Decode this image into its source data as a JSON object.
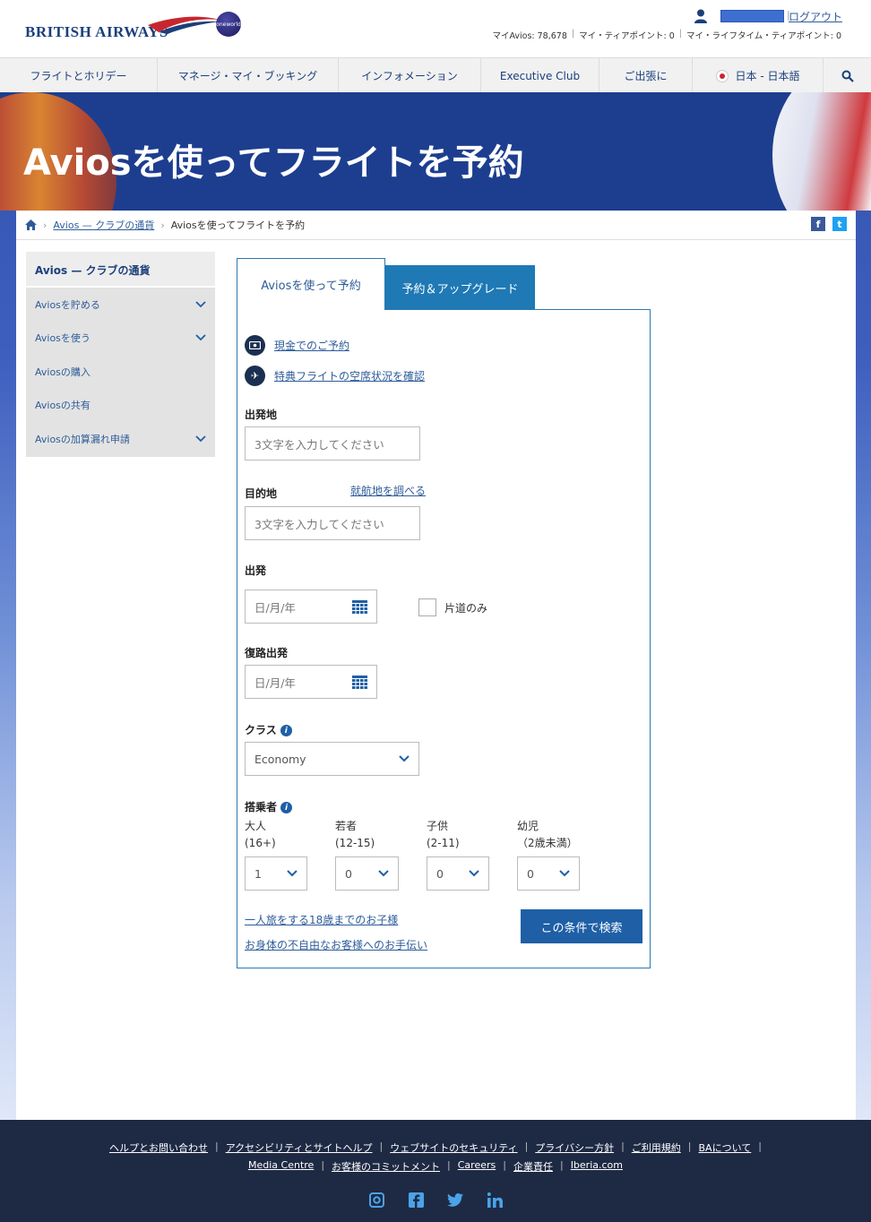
{
  "brand": {
    "logo_text": "BRITISH AIRWAYS",
    "alliance": "oneworld"
  },
  "account": {
    "logout_label": "ログアウト",
    "avios_label": "マイAvios: 78,678",
    "tier_points_label": "マイ・ティアポイント: 0",
    "lifetime_tier_points_label": "マイ・ライフタイム・ティアポイント: 0"
  },
  "nav": {
    "items": [
      {
        "label": "フライトとホリデー"
      },
      {
        "label": "マネージ・マイ・ブッキング"
      },
      {
        "label": "インフォメーション"
      },
      {
        "label": "Executive Club"
      },
      {
        "label": "ご出張に"
      },
      {
        "label": "日本 - 日本語"
      }
    ]
  },
  "hero": {
    "title": "Aviosを使ってフライトを予約"
  },
  "breadcrumb": {
    "link1": "Avios — クラブの通貨",
    "current": "Aviosを使ってフライトを予約"
  },
  "sidebar": {
    "title": "Avios — クラブの通貨",
    "items": [
      {
        "label": "Aviosを貯める"
      },
      {
        "label": "Aviosを使う"
      },
      {
        "label": "Aviosの購入"
      },
      {
        "label": "Aviosの共有"
      },
      {
        "label": "Aviosの加算漏れ申請"
      }
    ]
  },
  "tabs": {
    "active": "Aviosを使って予約",
    "inactive": "予約＆アップグレード"
  },
  "form": {
    "cash_link": "現金でのご予約",
    "availability_link": "特典フライトの空席状況を確認",
    "from_label": "出発地",
    "from_placeholder": "3文字を入力してください",
    "to_label": "目的地",
    "routes_link": "就航地を調べる",
    "to_placeholder": "3文字を入力してください",
    "depart_label": "出発",
    "date_placeholder": "日/月/年",
    "oneway_label": "片道のみ",
    "return_label": "復路出発",
    "class_label": "クラス",
    "class_value": "Economy",
    "passengers_label": "搭乗者",
    "adults_label": "大人",
    "adults_sub": "(16+)",
    "adults_value": "1",
    "youth_label": "若者",
    "youth_sub": "(12-15)",
    "youth_value": "0",
    "children_label": "子供",
    "children_sub": "(2-11)",
    "children_value": "0",
    "infants_label": "幼児",
    "infants_sub": "（2歳未満）",
    "infants_value": "0",
    "minors_link": "一人旅をする18歳までのお子様",
    "assistance_link": "お身体の不自由なお客様へのお手伝い",
    "search_button": "この条件で検索"
  },
  "footer": {
    "row1": [
      "ヘルプとお問い合わせ",
      "アクセシビリティとサイトヘルプ",
      "ウェブサイトのセキュリティ",
      "プライバシー方針",
      "ご利用規約",
      "BAについて"
    ],
    "row2": [
      "Media Centre",
      "お客様のコミットメント",
      "Careers",
      "企業責任",
      "Iberia.com"
    ]
  },
  "colors": {
    "primary": "#1e5fa6",
    "brand_navy": "#1b3f7b",
    "footer": "#1e2a44"
  }
}
